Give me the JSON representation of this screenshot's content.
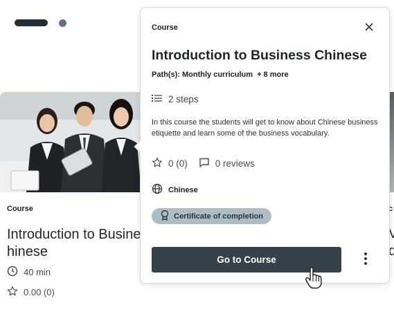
{
  "pager": {
    "dots": 2,
    "active_index": 0
  },
  "background_card": {
    "type_label": "Course",
    "title": "Introduction to Busine\nhinese",
    "duration": "40 min",
    "rating": "0.00 (0)",
    "image_alt": "three business professionals"
  },
  "right_card": {
    "type_fragment": "c",
    "title_fragment_1": "V",
    "title_fragment_2": "d"
  },
  "popover": {
    "type_label": "Course",
    "title": "Introduction to Business Chinese",
    "paths_label": "Path(s): Monthly curriculum",
    "paths_more": "+ 8 more",
    "steps": "2 steps",
    "description": "In this course the students will get to know about Chinese business etiquette and learn some of the business vocabulary.",
    "rating": "0 (0)",
    "reviews": "0 reviews",
    "language": "Chinese",
    "certificate": "Certificate of completion",
    "cta_label": "Go to Course",
    "icons": {
      "close": "close-icon",
      "steps": "list-icon",
      "rating": "star-outline-icon",
      "reviews": "comment-icon",
      "language": "globe-icon",
      "certificate": "ribbon-badge-icon",
      "more": "more-vertical-icon"
    }
  },
  "colors": {
    "primary_button": "#36414a",
    "badge_bg": "#aebdc5",
    "pager_active": "#252d32",
    "pager_inactive": "#5f7480"
  }
}
